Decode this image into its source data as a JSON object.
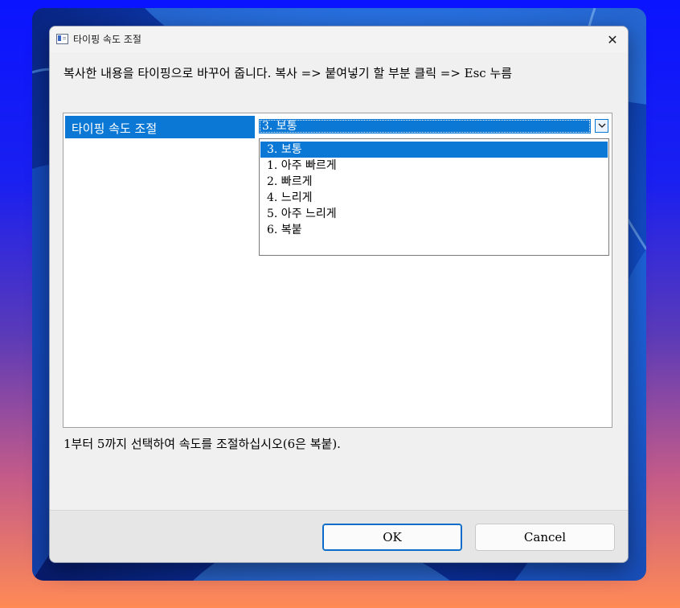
{
  "window": {
    "title": "타이핑 속도 조절",
    "description": "복사한 내용을 타이핑으로 바꾸어 줍니다. 복사 => 붙여넣기 할 부분 클릭 => Esc 누름",
    "close_symbol": "✕"
  },
  "property": {
    "label": "타이핑 속도 조절",
    "selected_value": "3. 보통",
    "options": [
      "3. 보통",
      "1. 아주 빠르게",
      "2. 빠르게",
      "4. 느리게",
      "5. 아주 느리게",
      "6. 복붙"
    ]
  },
  "hint": "1부터 5까지 선택하여 속도를 조절하십시오(6은 복붙).",
  "buttons": {
    "ok": "OK",
    "cancel": "Cancel"
  },
  "colors": {
    "accent": "#0a78d4",
    "dialog_bg": "#f0f0f0"
  },
  "icons": {
    "app": "window-icon",
    "close": "close-icon",
    "dropdown": "chevron-down-icon"
  }
}
